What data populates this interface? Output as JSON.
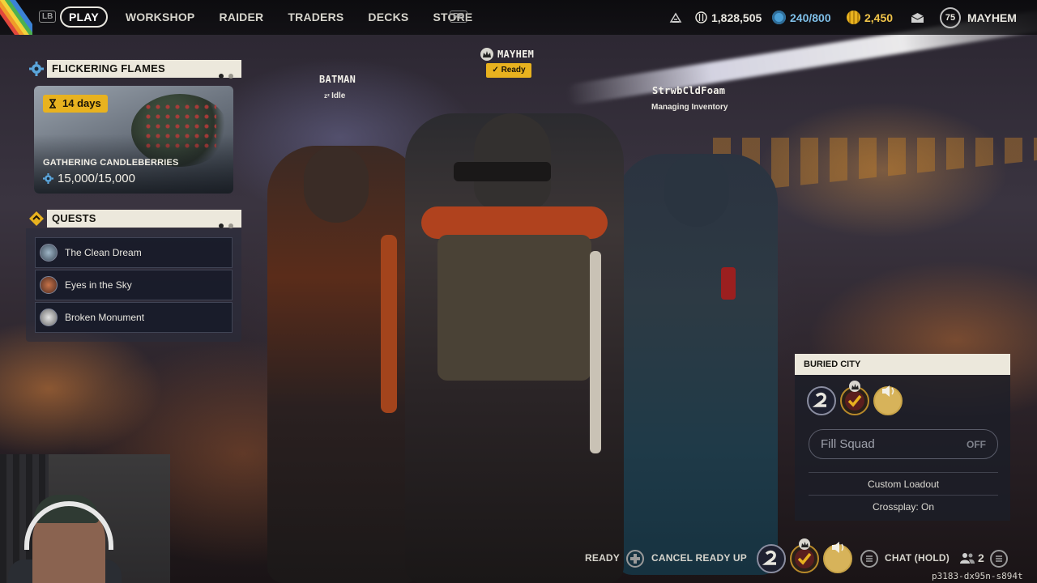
{
  "topbar": {
    "lb": "LB",
    "rb": "RB",
    "nav": [
      "PLAY",
      "WORKSHOP",
      "RAIDER",
      "TRADERS",
      "DECKS",
      "STORE"
    ],
    "active": "PLAY",
    "currencies": {
      "credits": "1,828,505",
      "tokens": "240/800",
      "coins": "2,450"
    },
    "player": {
      "level": "75",
      "name": "MAYHEM"
    }
  },
  "event": {
    "header": "FLICKERING FLAMES",
    "timer": "14 days",
    "title": "GATHERING CANDLEBERRIES",
    "progress": "15,000/15,000"
  },
  "quests": {
    "header": "QUESTS",
    "items": [
      "The Clean Dream",
      "Eyes in the Sky",
      "Broken Monument"
    ]
  },
  "party": {
    "leader": {
      "name": "MAYHEM",
      "status": "Ready"
    },
    "left": {
      "name": "BATMAN",
      "status": "Idle"
    },
    "right": {
      "name": "StrwbCldFoam",
      "status": "Managing Inventory"
    }
  },
  "squad": {
    "map": "BURIED CITY",
    "fill_label": "Fill Squad",
    "fill_value": "OFF",
    "custom_loadout": "Custom Loadout",
    "crossplay": "Crossplay: On"
  },
  "bottom": {
    "ready": "READY",
    "cancel": "CANCEL READY UP",
    "chat": "CHAT (HOLD)",
    "party_count": "2",
    "session": "p3183-dx95n-s894t"
  },
  "colors": {
    "accent_yellow": "#e8b21f",
    "panel_header": "#ece8dc",
    "token_blue": "#4a9fd6"
  }
}
